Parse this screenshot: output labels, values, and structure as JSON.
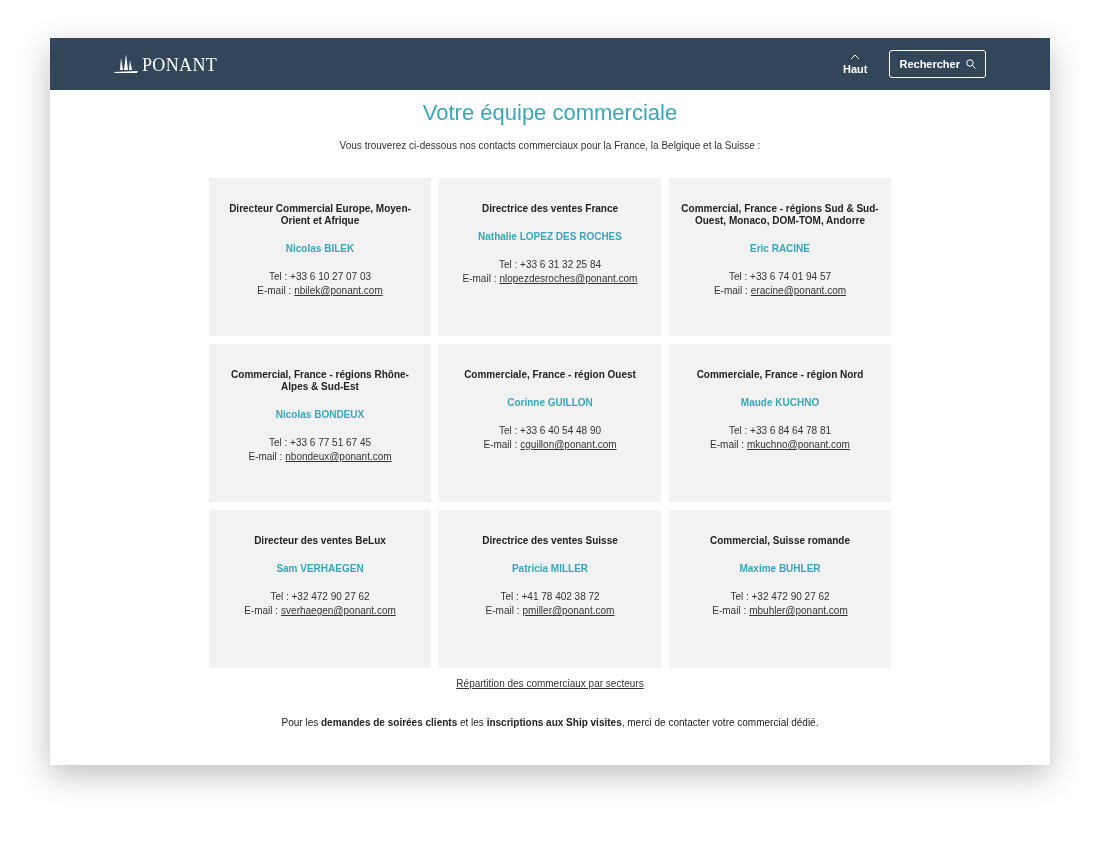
{
  "header": {
    "logo": "PONANT",
    "top_link": "Haut",
    "search_button": "Rechercher"
  },
  "title": "Votre équipe commerciale",
  "intro": "Vous trouverez ci-dessous nos contacts commerciaux pour la France, la Belgique et la Suisse :",
  "contacts": [
    {
      "role": "Directeur Commercial Europe, Moyen-Orient et Afrique",
      "name": "Nicolas BILEK",
      "tel": "Tel : +33 6 10 27 07 03",
      "email_label": "E-mail :",
      "email": "nbilek@ponant.com"
    },
    {
      "role": "Directrice des ventes France",
      "name": "Nathalie LOPEZ DES ROCHES",
      "tel": "Tel : +33 6 31 32 25 84",
      "email_label": "E-mail :",
      "email": "nlopezdesroches@ponant.com"
    },
    {
      "role": "Commercial, France - régions Sud & Sud-Ouest, Monaco, DOM-TOM, Andorre",
      "name": "Eric RACINE",
      "tel": "Tel : +33 6 74 01 94 57",
      "email_label": "E-mail :",
      "email": "eracine@ponant.com"
    },
    {
      "role": "Commercial, France - régions Rhône-Alpes & Sud-Est",
      "name": "Nicolas BONDEUX",
      "tel": "Tel : +33 6 77 51 67 45",
      "email_label": "E-mail :",
      "email": "nbondeux@ponant.com"
    },
    {
      "role": "Commerciale, France - région Ouest",
      "name": "Corinne GUILLON",
      "tel": "Tel : +33 6 40 54 48 90",
      "email_label": "E-mail :",
      "email": "cguillon@ponant.com"
    },
    {
      "role": "Commerciale, France - région Nord",
      "name": "Maude KUCHNO",
      "tel": "Tel : +33 6 84 64 78 81",
      "email_label": "E-mail :",
      "email": "mkuchno@ponant.com"
    },
    {
      "role": "Directeur des ventes BeLux",
      "name": "Sam VERHAEGEN",
      "tel": "Tel : +32 472 90 27 62",
      "email_label": "E-mail :",
      "email": "sverhaegen@ponant.com"
    },
    {
      "role": "Directrice des ventes Suisse",
      "name": "Patricia MILLER",
      "tel": "Tel : +41 78 402 38 72",
      "email_label": "E-mail :",
      "email": "pmiller@ponant.com"
    },
    {
      "role": "Commercial, Suisse romande",
      "name": "Maxime BUHLER",
      "tel": "Tel : +32 472 90 27 62",
      "email_label": "E-mail :",
      "email": "mbuhler@ponant.com"
    }
  ],
  "sectors_link": "Répartition des commerciaux par secteurs",
  "footer_note": "Pour les **demandes de soirées clients** et les **inscriptions aux Ship visites**, merci de contacter votre commercial dédié."
}
